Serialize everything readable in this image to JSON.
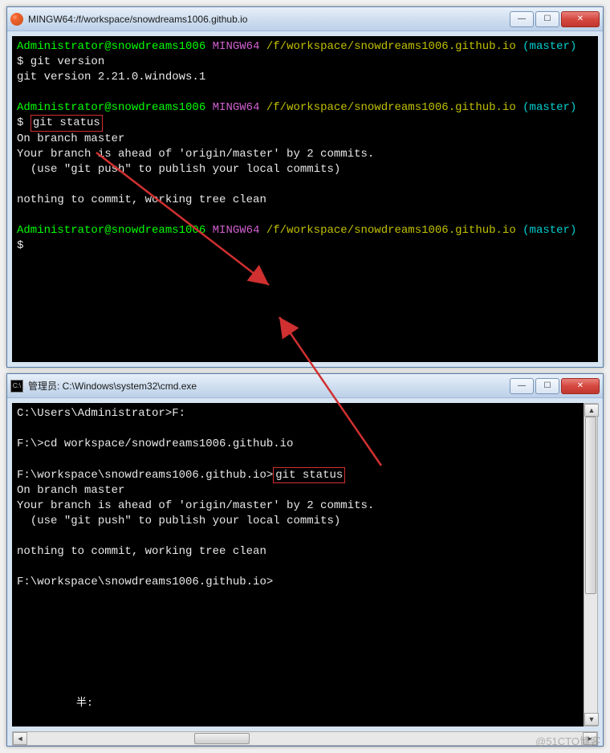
{
  "window1": {
    "title": "MINGW64:/f/workspace/snowdreams1006.github.io",
    "prompt_user": "Administrator@snowdreams1006",
    "prompt_env": "MINGW64",
    "prompt_path": "/f/workspace/snowdreams1006.github.io",
    "prompt_branch": "(master)",
    "cmd1": "$ git version",
    "out1": "git version 2.21.0.windows.1",
    "cmd2_prefix": "$ ",
    "cmd2_highlight": "git status",
    "status1": "On branch master",
    "status2": "Your branch is ahead of 'origin/master' by 2 commits.",
    "status3": "  (use \"git push\" to publish your local commits)",
    "status4": "nothing to commit, working tree clean",
    "cmd3": "$"
  },
  "window2": {
    "title": "管理员: C:\\Windows\\system32\\cmd.exe",
    "line1_prompt": "C:\\Users\\Administrator>",
    "line1_cmd": "F:",
    "line2_prompt": "F:\\>",
    "line2_cmd": "cd workspace/snowdreams1006.github.io",
    "line3_prompt": "F:\\workspace\\snowdreams1006.github.io>",
    "line3_highlight": "git status",
    "status1": "On branch master",
    "status2": "Your branch is ahead of 'origin/master' by 2 commits.",
    "status3": "  (use \"git push\" to publish your local commits)",
    "status4": "nothing to commit, working tree clean",
    "line4_prompt": "F:\\workspace\\snowdreams1006.github.io>",
    "bottom_label": "半:"
  },
  "buttons": {
    "min": "—",
    "max": "☐",
    "close": "✕",
    "left": "◄",
    "right": "►",
    "up": "▲",
    "down": "▼"
  },
  "watermark": "@51CTO博客"
}
